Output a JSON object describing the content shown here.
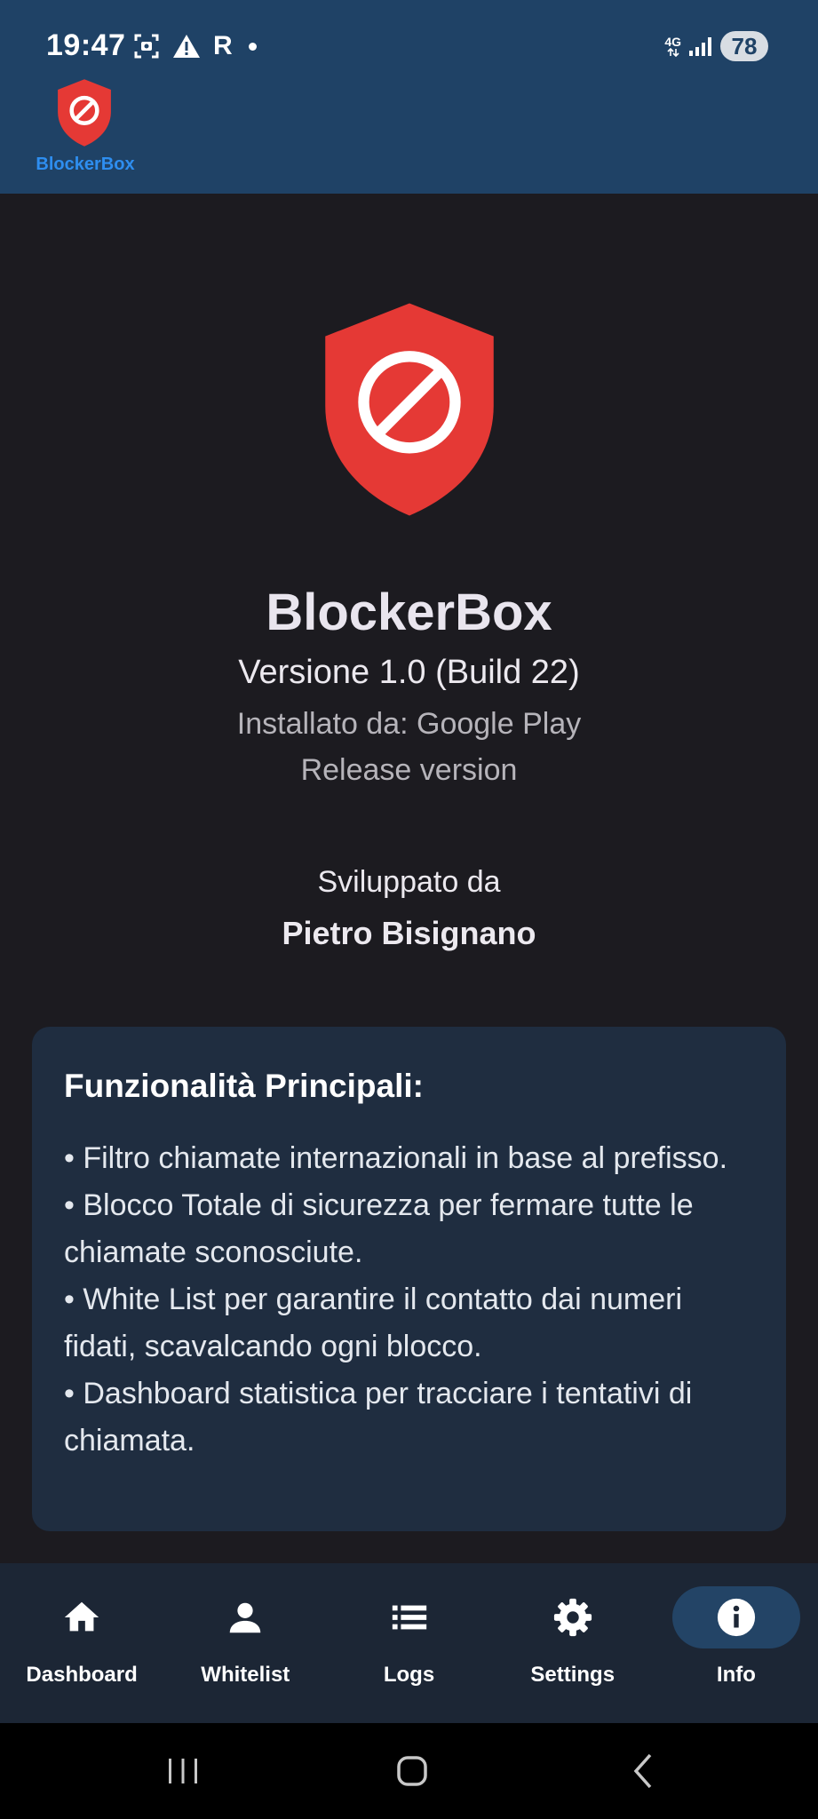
{
  "status_bar": {
    "time": "19:47",
    "r_indicator": "R",
    "network": "4G",
    "battery": "78"
  },
  "header": {
    "brand": "BlockerBox"
  },
  "about": {
    "app_name": "BlockerBox",
    "version": "Versione 1.0 (Build 22)",
    "installed_from": "Installato da: Google Play",
    "release": "Release version",
    "developed_by_label": "Sviluppato da",
    "developer": "Pietro Bisignano"
  },
  "features": {
    "title": "Funzionalità Principali:",
    "items": [
      "• Filtro chiamate internazionali in base al prefisso.",
      "• Blocco Totale di sicurezza per fermare tutte le chiamate sconosciute.",
      "• White List per garantire il contatto dai numeri fidati, scavalcando ogni blocco.",
      "• Dashboard statistica per tracciare i tentativi di chiamata."
    ]
  },
  "bottom_nav": {
    "items": [
      {
        "label": "Dashboard",
        "icon": "home-icon"
      },
      {
        "label": "Whitelist",
        "icon": "person-icon"
      },
      {
        "label": "Logs",
        "icon": "list-icon"
      },
      {
        "label": "Settings",
        "icon": "gear-icon"
      },
      {
        "label": "Info",
        "icon": "info-icon",
        "active": true
      }
    ]
  },
  "colors": {
    "header_bg": "#1f4266",
    "background": "#1c1b20",
    "card_bg": "#1f2d40",
    "shield_red": "#e53935",
    "brand_blue": "#2e8ef0",
    "nav_bg": "#1c2635",
    "nav_active_pill": "#234466"
  }
}
